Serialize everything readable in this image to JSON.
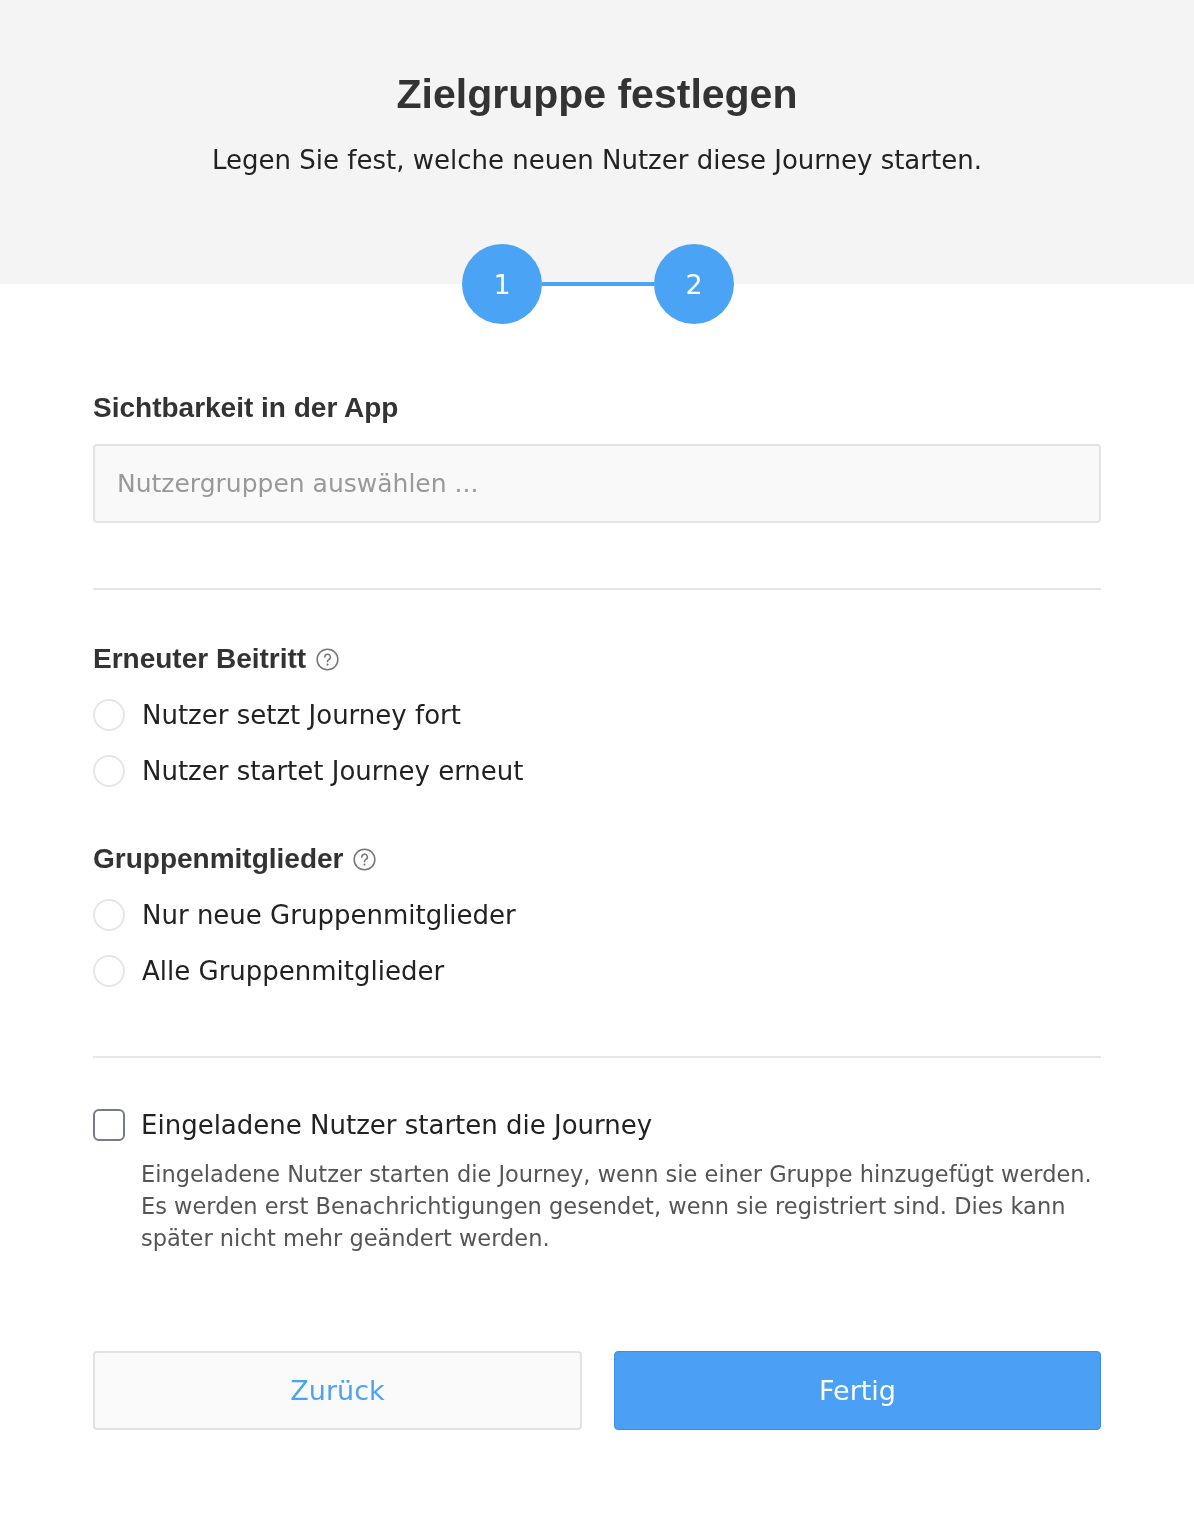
{
  "header": {
    "title": "Zielgruppe festlegen",
    "subtitle": "Legen Sie fest, welche neuen Nutzer diese Journey starten."
  },
  "steps": [
    {
      "label": "1"
    },
    {
      "label": "2"
    }
  ],
  "visibility": {
    "label": "Sichtbarkeit in der App",
    "placeholder": "Nutzergruppen auswählen ..."
  },
  "radio_groups": [
    {
      "label": "Erneuter Beitritt",
      "options": [
        {
          "label": "Nutzer setzt Journey fort",
          "selected": false
        },
        {
          "label": "Nutzer startet Journey erneut",
          "selected": false
        }
      ]
    },
    {
      "label": "Gruppenmitglieder",
      "options": [
        {
          "label": "Nur neue Gruppenmitglieder",
          "selected": false
        },
        {
          "label": "Alle Gruppenmitglieder",
          "selected": false
        }
      ]
    }
  ],
  "invite": {
    "label": "Eingeladene Nutzer starten die Journey",
    "checked": false,
    "description": "Eingeladene Nutzer starten die Journey, wenn sie einer Gruppe hinzugefügt werden. Es werden erst Benachrichtigungen gesendet, wenn sie registriert sind. Dies kann später nicht mehr geändert werden."
  },
  "buttons": [
    {
      "label": "Zurück",
      "kind": "secondary"
    },
    {
      "label": "Fertig",
      "kind": "primary"
    }
  ]
}
